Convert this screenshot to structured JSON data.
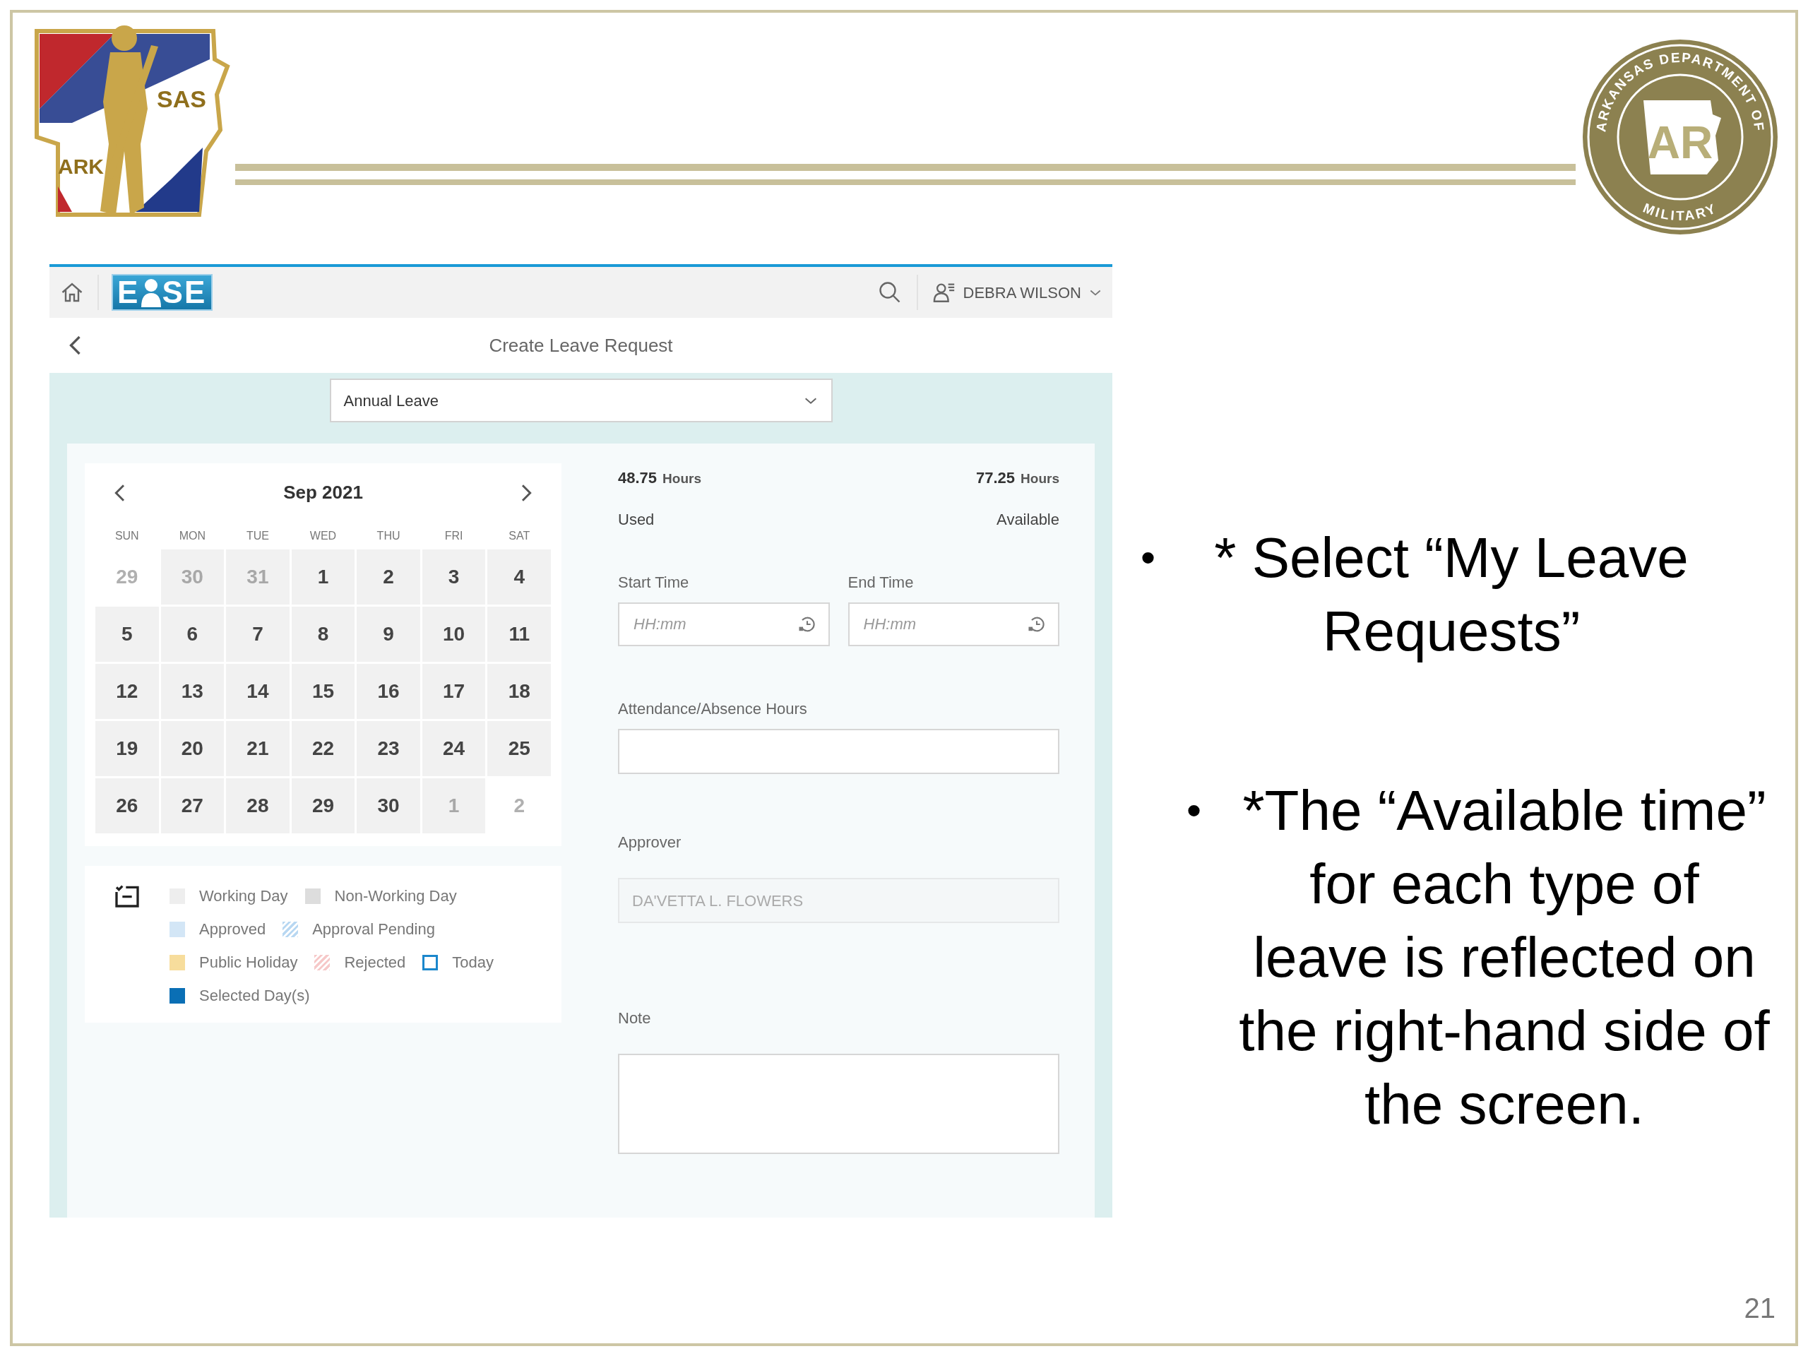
{
  "slide": {
    "logo": {
      "text_left": "ARK",
      "text_right": "SAS"
    },
    "seal": {
      "ring_top": "ARKANSAS DEPARTMENT OF",
      "ring_bottom": "MILITARY",
      "center": "AR"
    },
    "page_number": "21"
  },
  "app": {
    "brand": {
      "left": "E",
      "right": "SE"
    },
    "user_name": "DEBRA WILSON",
    "page_title": "Create Leave Request",
    "leave_type": "Annual Leave",
    "calendar": {
      "month": "Sep 2021",
      "weekdays": [
        "SUN",
        "MON",
        "TUE",
        "WED",
        "THU",
        "FRI",
        "SAT"
      ],
      "weeks": [
        [
          {
            "day": "29",
            "kind": "outside-blank"
          },
          {
            "day": "30",
            "kind": "outside"
          },
          {
            "day": "31",
            "kind": "outside"
          },
          {
            "day": "1",
            "kind": "working"
          },
          {
            "day": "2",
            "kind": "working"
          },
          {
            "day": "3",
            "kind": "working"
          },
          {
            "day": "4",
            "kind": "working"
          }
        ],
        [
          {
            "day": "5",
            "kind": "working"
          },
          {
            "day": "6",
            "kind": "working"
          },
          {
            "day": "7",
            "kind": "working"
          },
          {
            "day": "8",
            "kind": "working"
          },
          {
            "day": "9",
            "kind": "working"
          },
          {
            "day": "10",
            "kind": "working"
          },
          {
            "day": "11",
            "kind": "working"
          }
        ],
        [
          {
            "day": "12",
            "kind": "working"
          },
          {
            "day": "13",
            "kind": "working"
          },
          {
            "day": "14",
            "kind": "working"
          },
          {
            "day": "15",
            "kind": "working"
          },
          {
            "day": "16",
            "kind": "working"
          },
          {
            "day": "17",
            "kind": "working"
          },
          {
            "day": "18",
            "kind": "working"
          }
        ],
        [
          {
            "day": "19",
            "kind": "working"
          },
          {
            "day": "20",
            "kind": "working"
          },
          {
            "day": "21",
            "kind": "working"
          },
          {
            "day": "22",
            "kind": "working"
          },
          {
            "day": "23",
            "kind": "working"
          },
          {
            "day": "24",
            "kind": "working"
          },
          {
            "day": "25",
            "kind": "working"
          }
        ],
        [
          {
            "day": "26",
            "kind": "working"
          },
          {
            "day": "27",
            "kind": "working"
          },
          {
            "day": "28",
            "kind": "working"
          },
          {
            "day": "29",
            "kind": "working"
          },
          {
            "day": "30",
            "kind": "working"
          },
          {
            "day": "1",
            "kind": "outside"
          },
          {
            "day": "2",
            "kind": "outside-blank"
          }
        ]
      ]
    },
    "legend": [
      [
        {
          "label": "Working Day",
          "kind": "solid",
          "color": "#eeeeee"
        },
        {
          "label": "Non-Working Day",
          "kind": "solid",
          "color": "#dddddd"
        }
      ],
      [
        {
          "label": "Approved",
          "kind": "solid",
          "color": "#d3e6f6"
        },
        {
          "label": "Approval Pending",
          "kind": "hatched",
          "color": "#b9d8f2"
        }
      ],
      [
        {
          "label": "Public Holiday",
          "kind": "solid",
          "color": "#f7dd9c"
        },
        {
          "label": "Rejected",
          "kind": "hatched",
          "color": "#f6c9c9"
        },
        {
          "label": "Today",
          "kind": "outline",
          "color": "#1b87cc"
        }
      ],
      [
        {
          "label": "Selected Day(s)",
          "kind": "solid",
          "color": "#0a6fb5"
        }
      ]
    ],
    "balance": [
      {
        "value": "48.75",
        "unit": "Hours",
        "label": "Used"
      },
      {
        "value": "77.25",
        "unit": "Hours",
        "label": "Available"
      }
    ],
    "start_time": {
      "label": "Start Time",
      "placeholder": "HH:mm"
    },
    "end_time": {
      "label": "End Time",
      "placeholder": "HH:mm"
    },
    "hours": {
      "label": "Attendance/Absence Hours"
    },
    "approver": {
      "label": "Approver",
      "value": "DA'VETTA L. FLOWERS",
      "disabled": true
    },
    "note": {
      "label": "Note"
    }
  },
  "bullets": [
    {
      "marker": "•",
      "text": "* Select “My Leave Requests”"
    },
    {
      "marker": "•",
      "text": "*The “Available time” for each type of leave is reflected on the right-hand side of the screen."
    }
  ]
}
